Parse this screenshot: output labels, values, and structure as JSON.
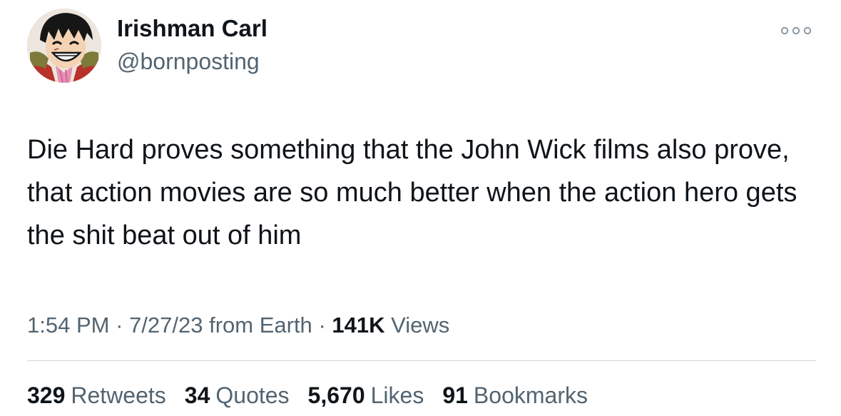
{
  "author": {
    "display_name": "Irishman Carl",
    "handle": "@bornposting",
    "avatar_icon": "anime-character-avatar"
  },
  "more_icon": "more-horizontal-icon",
  "tweet": {
    "text": "Die Hard proves something that the John Wick films also prove, that action movies are so much better when the action hero gets the shit beat out of him"
  },
  "meta": {
    "time": "1:54 PM",
    "date": "7/27/23",
    "source": "from Earth",
    "views_count": "141K",
    "views_label": "Views",
    "separator": "·"
  },
  "stats": {
    "retweets_count": "329",
    "retweets_label": "Retweets",
    "quotes_count": "34",
    "quotes_label": "Quotes",
    "likes_count": "5,670",
    "likes_label": "Likes",
    "bookmarks_count": "91",
    "bookmarks_label": "Bookmarks"
  },
  "colors": {
    "primary_text": "#0f1419",
    "secondary_text": "#536471",
    "divider": "#cfd9de",
    "background": "#ffffff"
  }
}
